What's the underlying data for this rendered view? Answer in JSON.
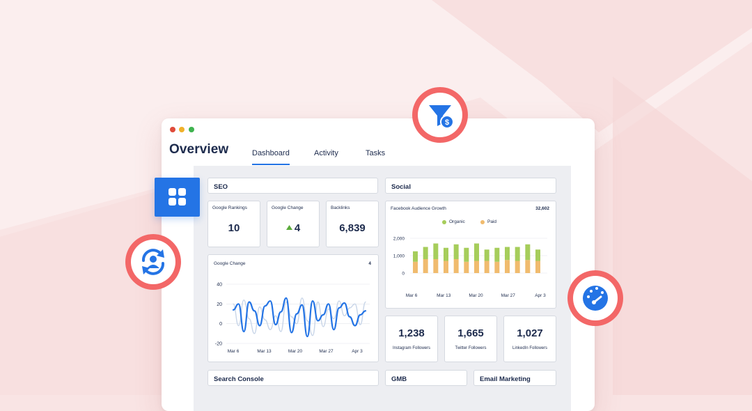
{
  "window": {
    "title": "Overview",
    "tabs": [
      "Dashboard",
      "Activity",
      "Tasks"
    ],
    "active_tab": "Dashboard"
  },
  "sections": {
    "seo": "SEO",
    "social": "Social",
    "search_console": "Search Console",
    "gmb": "GMB",
    "email_marketing": "Email Marketing"
  },
  "seo_stats": [
    {
      "label": "Google Rankings",
      "value": "10"
    },
    {
      "label": "Google Change",
      "value": "4",
      "trend": "up"
    },
    {
      "label": "Backlinks",
      "value": "6,839"
    }
  ],
  "google_change_chart": {
    "title": "Google Change",
    "value": "4"
  },
  "facebook_chart": {
    "title": "Facebook Audience Growth",
    "total": "32,602",
    "legend_organic": "Organic",
    "legend_paid": "Paid"
  },
  "social_stats": [
    {
      "label": "Instagram Followers",
      "value": "1,238"
    },
    {
      "label": "Twitter Followers",
      "value": "1,665"
    },
    {
      "label": "LinkedIn Followers",
      "value": "1,027"
    }
  ],
  "colors": {
    "accent": "#2474e5",
    "organic": "#a6cd5b",
    "paid": "#f0bb6e",
    "badge": "#f36767",
    "navy": "#1d2b4d"
  },
  "icons": [
    "funnel-dollar-icon",
    "grid-icon",
    "user-sync-icon",
    "gauge-icon"
  ],
  "chart_data": [
    {
      "type": "line",
      "title": "Google Change",
      "x_ticks": [
        "Mar 6",
        "Mar 13",
        "Mar 20",
        "Mar 27",
        "Apr 3"
      ],
      "y_ticks": [
        "40",
        "20",
        "0",
        "-20"
      ],
      "ylim": [
        -20,
        40
      ],
      "series": [
        {
          "values": [
            20,
            -2,
            24,
            5,
            -10,
            17,
            4,
            -6,
            8,
            -8,
            22,
            7,
            0,
            26,
            3,
            -12,
            22,
            -3,
            15,
            5,
            23,
            8,
            16,
            20,
            -1,
            22
          ]
        },
        {
          "values": [
            14,
            20,
            -8,
            22,
            13,
            -2,
            18,
            23,
            -1,
            12,
            26,
            -9,
            10,
            19,
            -13,
            23,
            3,
            9,
            20,
            -6,
            16,
            21,
            7,
            -2,
            9,
            13
          ]
        }
      ]
    },
    {
      "type": "bar",
      "title": "Facebook Audience Growth",
      "categories": [
        "Mar 6",
        "",
        "",
        "Mar 13",
        "",
        "",
        "Mar 20",
        "",
        "",
        "Mar 27",
        "",
        "",
        "Apr 3"
      ],
      "x_ticks": [
        "Mar 6",
        "Mar 13",
        "Mar 20",
        "Mar 27",
        "Apr 3"
      ],
      "y_ticks": [
        "2,000",
        "1,000",
        "0"
      ],
      "ylim": [
        0,
        2000
      ],
      "series": [
        {
          "name": "Organic",
          "values": [
            600,
            700,
            900,
            750,
            850,
            800,
            1000,
            650,
            800,
            750,
            800,
            900,
            650
          ]
        },
        {
          "name": "Paid",
          "values": [
            650,
            800,
            800,
            700,
            800,
            650,
            700,
            700,
            650,
            750,
            700,
            750,
            700
          ]
        }
      ]
    }
  ]
}
